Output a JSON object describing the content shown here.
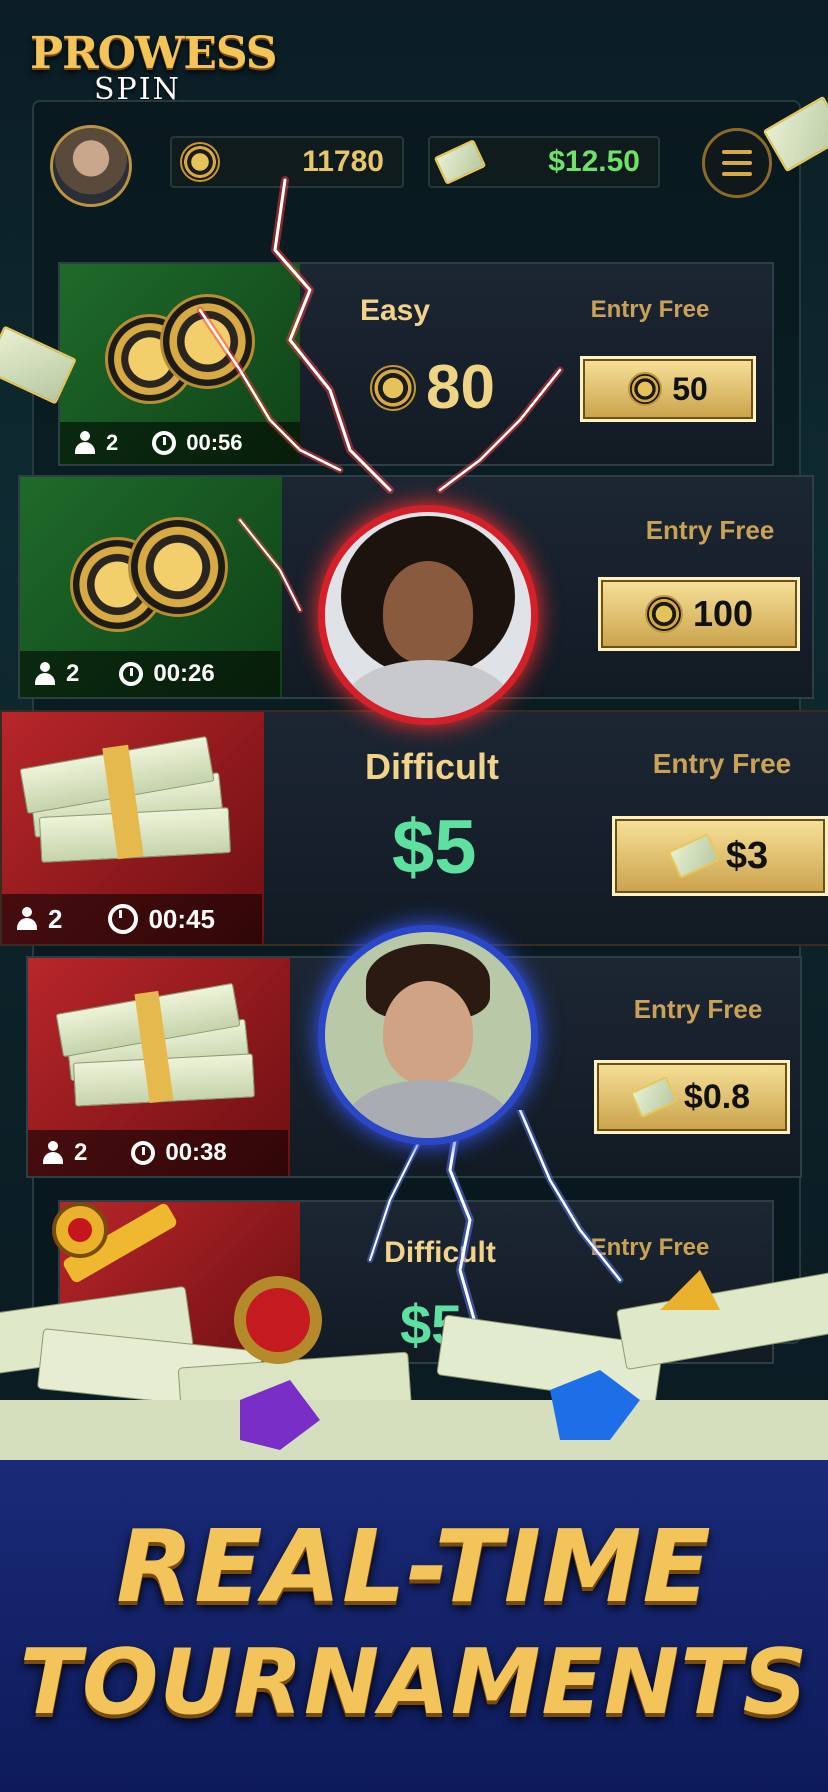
{
  "logo": {
    "line1": "PROWESS",
    "line2": "SPIN"
  },
  "header": {
    "avatar_icon": "player-avatar",
    "coins": "11780",
    "cash": "$12.50",
    "menu_icon": "hamburger-menu-icon"
  },
  "tournaments": [
    {
      "level": "Easy",
      "prize": "80",
      "prize_type": "coins",
      "entry_label": "Entry Free",
      "fee": "50",
      "fee_type": "coins",
      "players": "2",
      "timer": "00:56",
      "theme": "green"
    },
    {
      "level": "",
      "prize": "",
      "prize_type": "coins",
      "entry_label": "Entry Free",
      "fee": "100",
      "fee_type": "coins",
      "players": "2",
      "timer": "00:26",
      "theme": "green"
    },
    {
      "level": "Difficult",
      "prize": "$5",
      "prize_type": "cash",
      "entry_label": "Entry Free",
      "fee": "$3",
      "fee_type": "cash",
      "players": "2",
      "timer": "00:45",
      "theme": "red"
    },
    {
      "level": "",
      "prize": "",
      "prize_type": "cash",
      "entry_label": "Entry Free",
      "fee": "$0.8",
      "fee_type": "cash",
      "players": "2",
      "timer": "00:38",
      "theme": "red"
    },
    {
      "level": "Difficult",
      "prize": "$5",
      "prize_type": "cash",
      "entry_label": "Entry Free",
      "fee": "",
      "fee_type": "cash",
      "players": "",
      "timer": "",
      "theme": "red"
    }
  ],
  "banner": {
    "line1": "REAL-TIME",
    "line2": "TOURNAMENTS"
  },
  "colors": {
    "gold": "#f3c45a",
    "green_cash": "#6fe06a",
    "card_green": "#1f6a2a",
    "card_red": "#b8262a",
    "banner_blue": "#1b2a78"
  }
}
